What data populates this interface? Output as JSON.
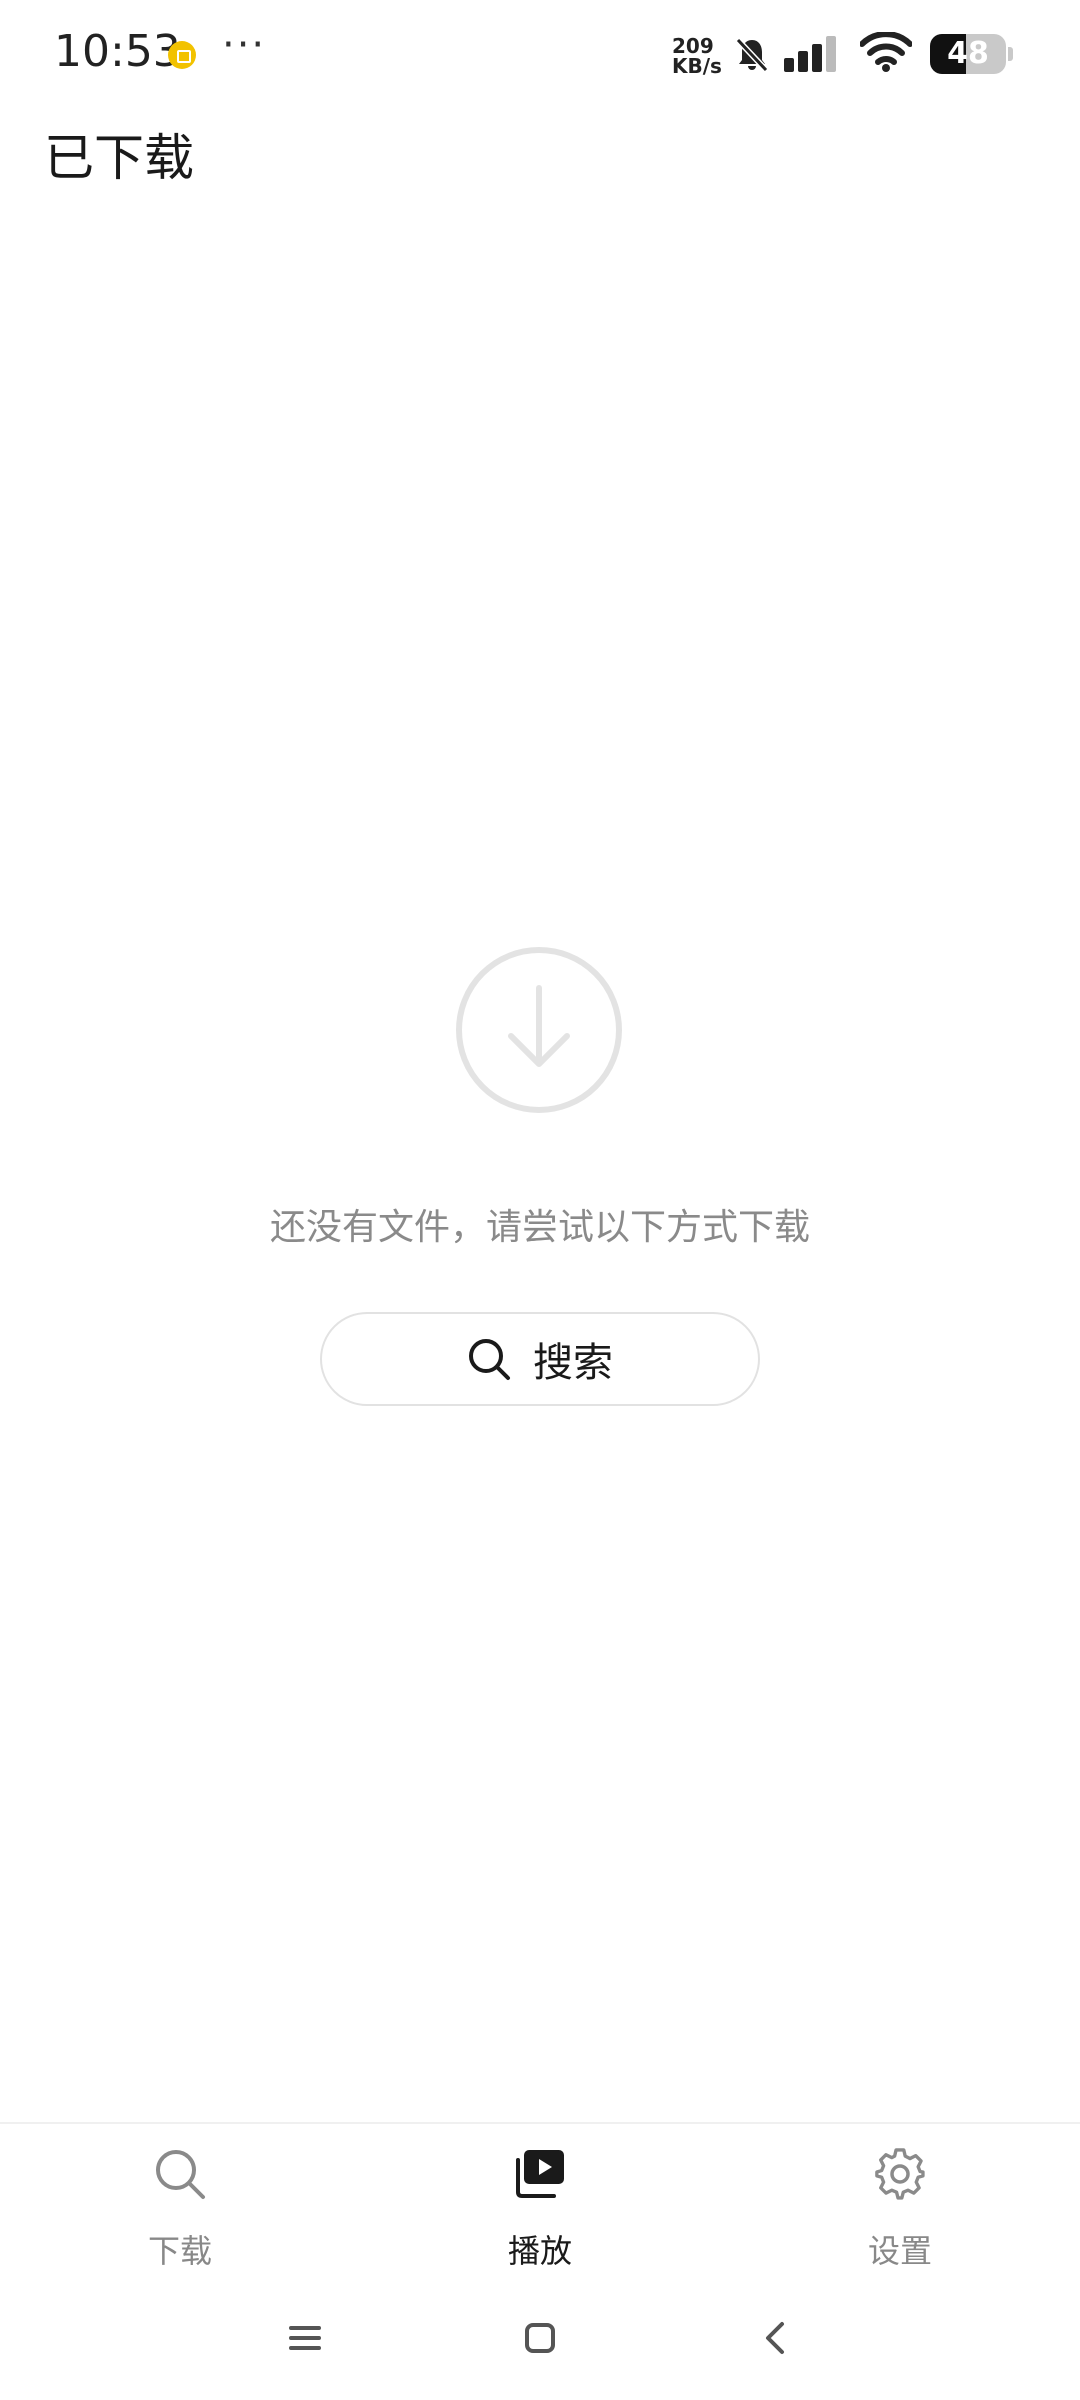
{
  "status_bar": {
    "time": "10:53",
    "more": "···",
    "net_speed_value": "209",
    "net_speed_unit": "KB/s",
    "battery_level": "48",
    "battery_fraction": 0.48
  },
  "header": {
    "title": "已下载"
  },
  "empty_state": {
    "icon": "download-circle-icon",
    "message": "还没有文件，请尝试以下方式下载",
    "search_button_label": "搜索"
  },
  "bottom_nav": {
    "items": [
      {
        "label": "下载",
        "icon": "search-icon",
        "active": false
      },
      {
        "label": "播放",
        "icon": "play-library-icon",
        "active": true
      },
      {
        "label": "设置",
        "icon": "gear-icon",
        "active": false
      }
    ]
  },
  "system_nav": {
    "buttons": [
      "menu-icon",
      "home-icon",
      "back-icon"
    ]
  },
  "colors": {
    "accent_dot": "#f2c200",
    "text_primary": "#1a1a1a",
    "text_secondary": "#8a8a8a",
    "divider": "#f0f0f0"
  }
}
